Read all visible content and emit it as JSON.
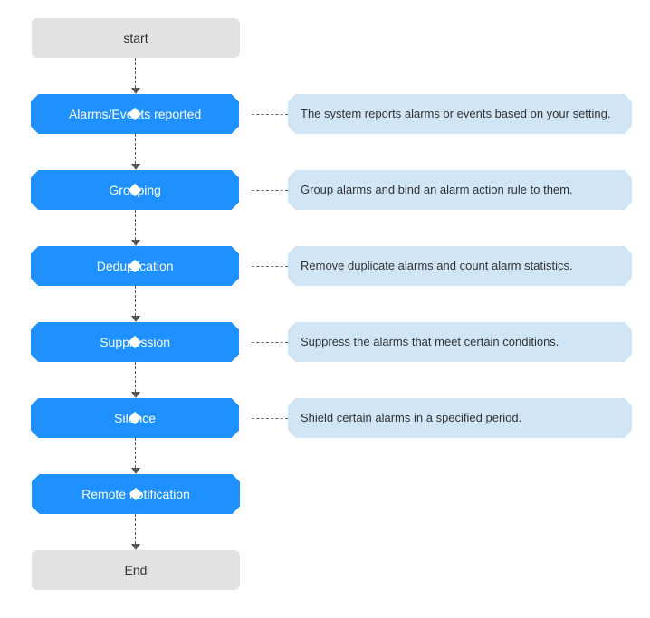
{
  "flowchart": {
    "start": "start",
    "end": "End",
    "steps": [
      {
        "label": "Alarms/Events reported",
        "desc": "The system reports alarms or events based on your setting."
      },
      {
        "label": "Grouping",
        "desc": "Group alarms and bind an alarm action rule to them."
      },
      {
        "label": "Deduplication",
        "desc": "Remove duplicate alarms and count alarm statistics."
      },
      {
        "label": "Suppression",
        "desc": "Suppress the alarms that meet certain conditions."
      },
      {
        "label": "Silence",
        "desc": "Shield certain alarms in a specified period."
      },
      {
        "label": "Remote notification",
        "desc": ""
      }
    ]
  }
}
